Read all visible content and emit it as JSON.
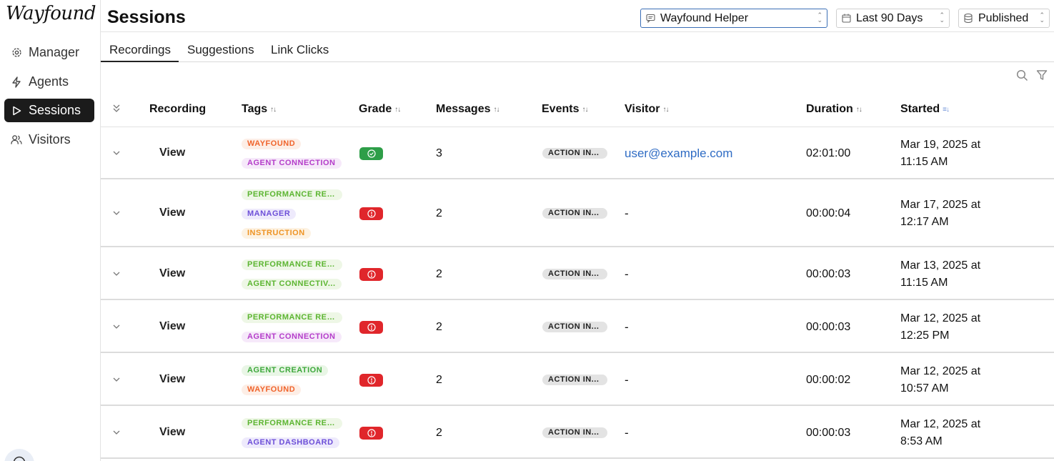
{
  "app": {
    "logo_text": "Wayfound"
  },
  "sidebar": {
    "items": [
      {
        "label": "Manager",
        "icon": "gear-icon",
        "active": false
      },
      {
        "label": "Agents",
        "icon": "bolt-icon",
        "active": false
      },
      {
        "label": "Sessions",
        "icon": "play-icon",
        "active": true
      },
      {
        "label": "Visitors",
        "icon": "users-icon",
        "active": false
      }
    ]
  },
  "header": {
    "title": "Sessions",
    "agent_select": {
      "value": "Wayfound Helper"
    },
    "date_select": {
      "value": "Last 90 Days"
    },
    "status_select": {
      "value": "Published"
    }
  },
  "tabs": [
    {
      "label": "Recordings",
      "active": true
    },
    {
      "label": "Suggestions",
      "active": false
    },
    {
      "label": "Link Clicks",
      "active": false
    }
  ],
  "table": {
    "columns": {
      "recording": "Recording",
      "tags": "Tags",
      "grade": "Grade",
      "messages": "Messages",
      "events": "Events",
      "visitor": "Visitor",
      "duration": "Duration",
      "started": "Started"
    },
    "rows": [
      {
        "view": "View",
        "tags": [
          {
            "label": "WAYFOUND",
            "color": "#f0642c",
            "bg": "#fdeee6"
          },
          {
            "label": "AGENT CONNECTION",
            "color": "#b43dc9",
            "bg": "#f6e9fa"
          }
        ],
        "grade": "good",
        "messages": "3",
        "event": "ACTION IN...",
        "visitor": "user@example.com",
        "visitor_is_link": true,
        "duration": "02:01:00",
        "started_1": "Mar 19, 2025 at",
        "started_2": "11:15 AM"
      },
      {
        "view": "View",
        "tags": [
          {
            "label": "PERFORMANCE REV...",
            "color": "#5cb531",
            "bg": "#eef7e6"
          },
          {
            "label": "MANAGER",
            "color": "#6d4fd8",
            "bg": "#eeeafc"
          },
          {
            "label": "INSTRUCTION",
            "color": "#ee9424",
            "bg": "#fdf2e2"
          }
        ],
        "grade": "bad",
        "messages": "2",
        "event": "ACTION IN...",
        "visitor": "-",
        "visitor_is_link": false,
        "duration": "00:00:04",
        "started_1": "Mar 17, 2025 at",
        "started_2": "12:17 AM"
      },
      {
        "view": "View",
        "tags": [
          {
            "label": "PERFORMANCE REV...",
            "color": "#5cb531",
            "bg": "#eef7e6"
          },
          {
            "label": "AGENT CONNECTIV...",
            "color": "#5cb531",
            "bg": "#eef7e6"
          }
        ],
        "grade": "bad",
        "messages": "2",
        "event": "ACTION IN...",
        "visitor": "-",
        "visitor_is_link": false,
        "duration": "00:00:03",
        "started_1": "Mar 13, 2025 at",
        "started_2": "11:15 AM"
      },
      {
        "view": "View",
        "tags": [
          {
            "label": "PERFORMANCE REV...",
            "color": "#5cb531",
            "bg": "#eef7e6"
          },
          {
            "label": "AGENT CONNECTION",
            "color": "#b43dc9",
            "bg": "#f6e9fa"
          }
        ],
        "grade": "bad",
        "messages": "2",
        "event": "ACTION IN...",
        "visitor": "-",
        "visitor_is_link": false,
        "duration": "00:00:03",
        "started_1": "Mar 12, 2025 at",
        "started_2": "12:25 PM"
      },
      {
        "view": "View",
        "tags": [
          {
            "label": "AGENT CREATION",
            "color": "#3ea83c",
            "bg": "#e9f6e6"
          },
          {
            "label": "WAYFOUND",
            "color": "#f0642c",
            "bg": "#fdeee6"
          }
        ],
        "grade": "bad",
        "messages": "2",
        "event": "ACTION IN...",
        "visitor": "-",
        "visitor_is_link": false,
        "duration": "00:00:02",
        "started_1": "Mar 12, 2025 at",
        "started_2": "10:57 AM"
      },
      {
        "view": "View",
        "tags": [
          {
            "label": "PERFORMANCE REV...",
            "color": "#5cb531",
            "bg": "#eef7e6"
          },
          {
            "label": "AGENT DASHBOARD",
            "color": "#6d4fd8",
            "bg": "#eeeafc"
          }
        ],
        "grade": "bad",
        "messages": "2",
        "event": "ACTION IN...",
        "visitor": "-",
        "visitor_is_link": false,
        "duration": "00:00:03",
        "started_1": "Mar 12, 2025 at",
        "started_2": "8:53 AM"
      }
    ]
  }
}
